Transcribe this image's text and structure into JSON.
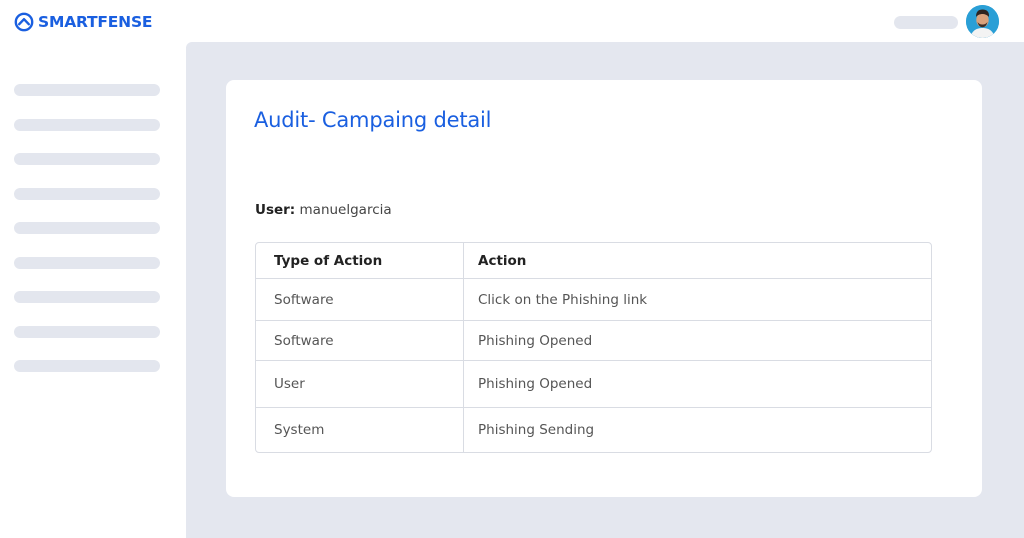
{
  "brand": {
    "name": "SMARTFENSE",
    "color": "#1a5fe0"
  },
  "header": {
    "user_avatar": "user-avatar"
  },
  "sidebar": {
    "item_count": 9
  },
  "page": {
    "title": "Audit- Campaing detail",
    "user_label": "User:",
    "user_value": "manuelgarcia"
  },
  "table": {
    "columns": [
      "Type of Action",
      "Action"
    ],
    "rows": [
      {
        "type": "Software",
        "action": "Click on the Phishing link"
      },
      {
        "type": "Software",
        "action": "Phishing Opened"
      },
      {
        "type": "User",
        "action": "Phishing Opened"
      },
      {
        "type": "System",
        "action": "Phishing Sending"
      }
    ]
  }
}
